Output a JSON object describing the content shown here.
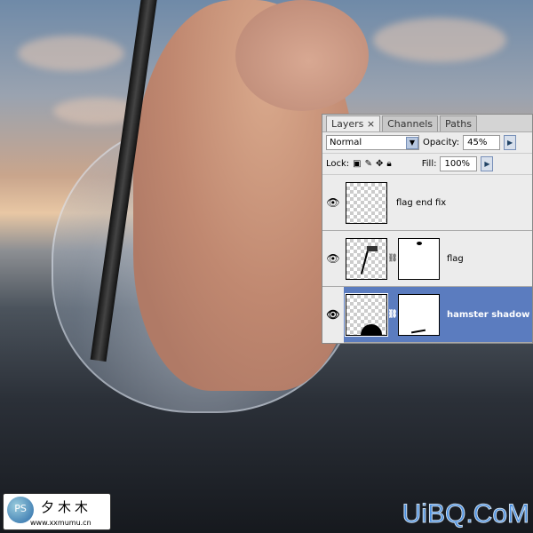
{
  "panel": {
    "tabs": [
      {
        "label": "Layers ×"
      },
      {
        "label": "Channels"
      },
      {
        "label": "Paths"
      }
    ],
    "blend_mode": "Normal",
    "opacity_label": "Opacity:",
    "opacity": "45%",
    "lock_label": "Lock:",
    "fill_label": "Fill:",
    "fill": "100%",
    "layers": [
      {
        "name": "flag end fix",
        "visible": true,
        "selected": false
      },
      {
        "name": "flag",
        "visible": true,
        "selected": false
      },
      {
        "name": "hamster shadow",
        "visible": true,
        "selected": true
      }
    ]
  },
  "watermarks": {
    "left_url": "www.xxmumu.cn",
    "left_chars": "夕木木",
    "right": "UiBQ.CoM"
  },
  "colors": {
    "selected_layer": "#5b7cbf"
  }
}
